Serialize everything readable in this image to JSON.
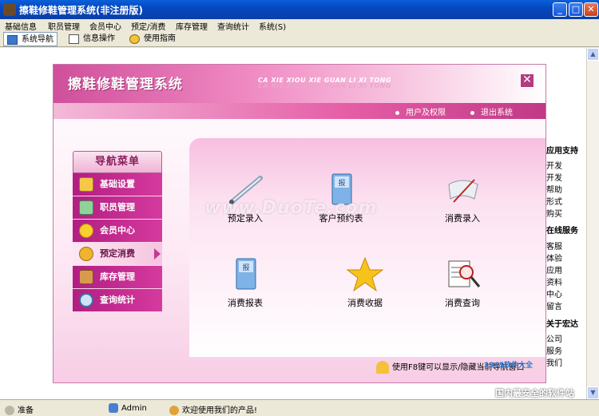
{
  "window": {
    "title": "擦鞋修鞋管理系统(非注册版)",
    "minimize": "_",
    "maximize": "□",
    "close": "✕"
  },
  "menu": [
    "基础信息",
    "职员管理",
    "会员中心",
    "预定/消费",
    "库存管理",
    "查询统计",
    "系统(S)"
  ],
  "toolbar": {
    "tabs": [
      "系统导航",
      "信息操作",
      "使用指南"
    ]
  },
  "side_panel": {
    "sections": [
      {
        "head": "应用支持",
        "items": [
          "开发",
          "开发",
          "帮助",
          "形式",
          "购买"
        ]
      },
      {
        "head": "在线服务",
        "items": [
          "客服",
          "体验",
          "应用",
          "资料",
          "中心",
          "留言"
        ]
      },
      {
        "head": "关于宏达",
        "items": [
          "公司",
          "服务",
          "我们"
        ]
      }
    ]
  },
  "dialog": {
    "title": "擦鞋修鞋管理系统",
    "subtitle": "CA XIE XIOU XIE GUAN LI XI TONG",
    "close": "✕",
    "links": [
      "用户及权限",
      "退出系统"
    ],
    "nav_title": "导航菜单",
    "nav_items": [
      {
        "label": "基础设置",
        "icon": "document-icon"
      },
      {
        "label": "职员管理",
        "icon": "staff-icon"
      },
      {
        "label": "会员中心",
        "icon": "star-icon"
      },
      {
        "label": "预定消费",
        "icon": "coins-icon",
        "active": true
      },
      {
        "label": "库存管理",
        "icon": "box-icon"
      },
      {
        "label": "查询统计",
        "icon": "magnifier-icon"
      }
    ],
    "tiles": [
      {
        "label": "预定录入",
        "icon": "pen-icon"
      },
      {
        "label": "客户预约表",
        "icon": "report-icon"
      },
      {
        "label": "消费录入",
        "icon": "scroll-icon"
      },
      {
        "label": "消费报表",
        "icon": "report-icon"
      },
      {
        "label": "消费收据",
        "icon": "star-icon"
      },
      {
        "label": "消费查询",
        "icon": "search-report-icon"
      }
    ],
    "hint": "使用F8键可以显示/隐藏当前导航窗口"
  },
  "watermark": {
    "main": "www.DuoTe.com",
    "corner": "2345软件大全",
    "bottom": "国内最安全的软件站"
  },
  "status": {
    "ready": "准备",
    "user": "Admin",
    "welcome": "欢迎使用我们的产品!"
  },
  "colors": {
    "accent": "#c13986",
    "titlebar": "#0548c0"
  }
}
